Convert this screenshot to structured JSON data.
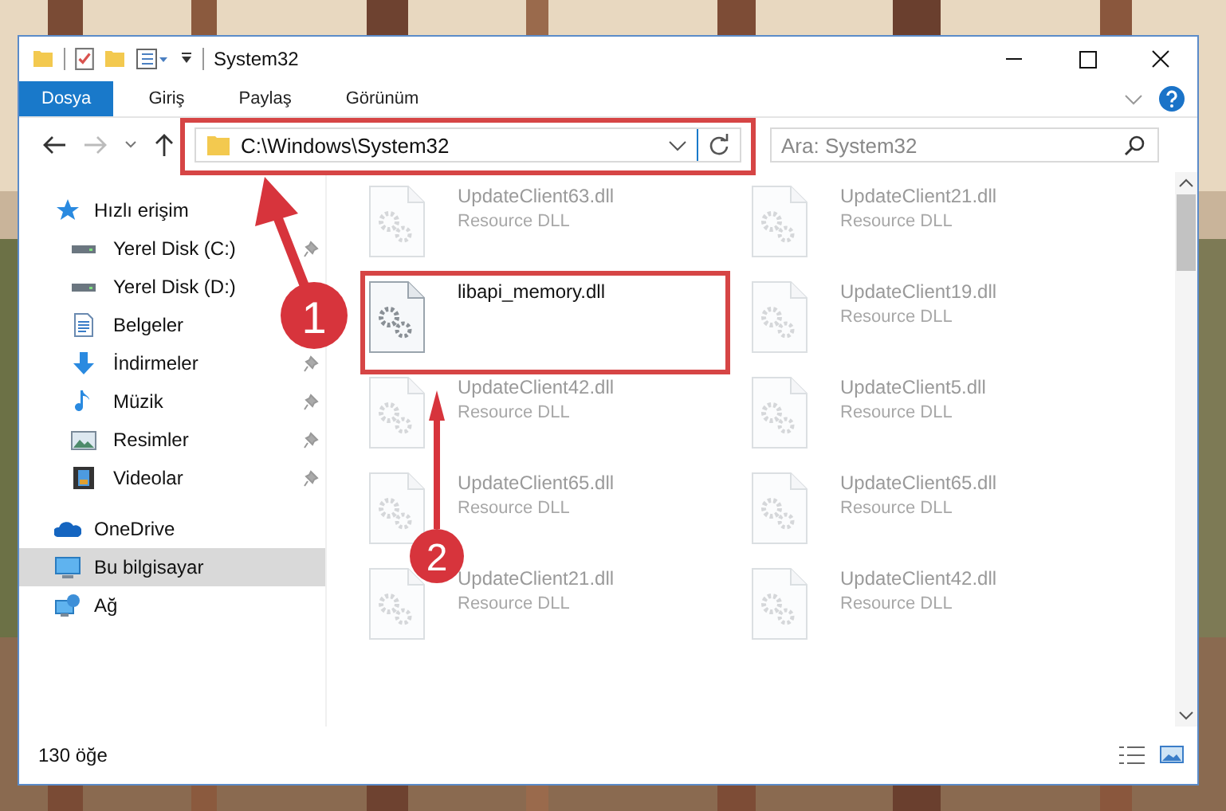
{
  "window": {
    "title": "System32"
  },
  "ribbon_tabs": [
    {
      "label": "Dosya",
      "selected": true
    },
    {
      "label": "Giriş",
      "selected": false
    },
    {
      "label": "Paylaş",
      "selected": false
    },
    {
      "label": "Görünüm",
      "selected": false
    }
  ],
  "address_bar": {
    "path": "C:\\Windows\\System32"
  },
  "search": {
    "placeholder": "Ara: System32"
  },
  "sidebar": {
    "items": [
      {
        "label": "Hızlı erişim",
        "kind": "star",
        "selected": false,
        "children": [
          {
            "label": "Yerel Disk (C:)",
            "kind": "drive",
            "selected": false,
            "pinned": true
          },
          {
            "label": "Yerel Disk (D:)",
            "kind": "drive",
            "selected": false,
            "pinned": false
          },
          {
            "label": "Belgeler",
            "kind": "document",
            "selected": false,
            "pinned": false
          },
          {
            "label": "İndirmeler",
            "kind": "download",
            "selected": false,
            "pinned": true
          },
          {
            "label": "Müzik",
            "kind": "music",
            "selected": false,
            "pinned": true
          },
          {
            "label": "Resimler",
            "kind": "pictures",
            "selected": false,
            "pinned": true
          },
          {
            "label": "Videolar",
            "kind": "videos",
            "selected": false,
            "pinned": true
          }
        ]
      },
      {
        "label": "OneDrive",
        "kind": "cloud",
        "selected": false
      },
      {
        "label": "Bu bilgisayar",
        "kind": "computer",
        "selected": true
      },
      {
        "label": "Ağ",
        "kind": "network",
        "selected": false
      }
    ]
  },
  "files": [
    {
      "name": "UpdateClient63.dll",
      "type": "Resource DLL",
      "dimmed": true
    },
    {
      "name": "UpdateClient21.dll",
      "type": "Resource DLL",
      "dimmed": true
    },
    {
      "name": "libapi_memory.dll",
      "dimmed": false
    },
    {
      "name": "UpdateClient19.dll",
      "type": "Resource DLL",
      "dimmed": true
    },
    {
      "name": "UpdateClient42.dll",
      "type": "Resource DLL",
      "dimmed": true
    },
    {
      "name": "UpdateClient5.dll",
      "type": "Resource DLL",
      "dimmed": true
    },
    {
      "name": "UpdateClient65.dll",
      "type": "Resource DLL",
      "dimmed": true
    },
    {
      "name": "UpdateClient65.dll",
      "type": "Resource DLL",
      "dimmed": true
    },
    {
      "name": "UpdateClient21.dll",
      "type": "Resource DLL",
      "dimmed": true
    },
    {
      "name": "UpdateClient42.dll",
      "type": "Resource DLL",
      "dimmed": true
    }
  ],
  "status_bar": {
    "count": "130 öğe"
  },
  "annotations": [
    {
      "number": "1"
    },
    {
      "number": "2"
    }
  ]
}
